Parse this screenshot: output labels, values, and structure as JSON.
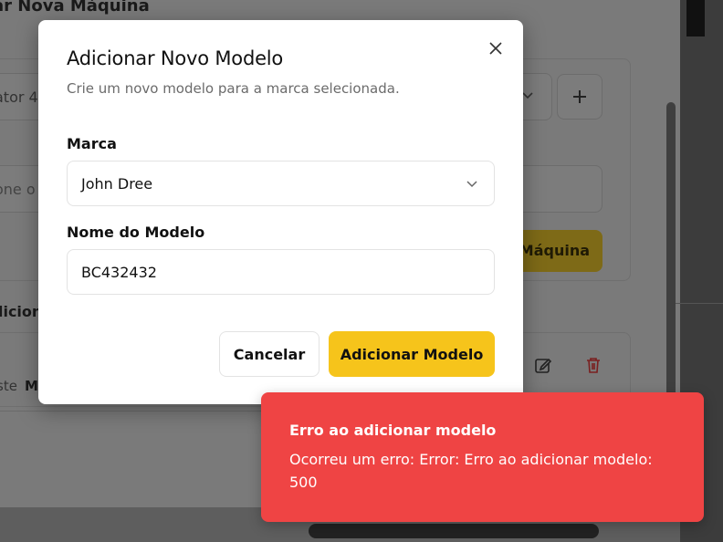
{
  "background": {
    "title": "ar Nova Máquina",
    "select_text": "ator 4x",
    "input_text": "one o",
    "button_label": "Máquina",
    "section_title": "dicion",
    "row_text": "ste",
    "row_bold": "M"
  },
  "dialog": {
    "title": "Adicionar Novo Modelo",
    "description": "Crie um novo modelo para a marca selecionada.",
    "brand_label": "Marca",
    "brand_value": "John Dree",
    "model_label": "Nome do Modelo",
    "model_value": "BC432432",
    "cancel_label": "Cancelar",
    "submit_label": "Adicionar Modelo"
  },
  "toast": {
    "title": "Erro ao adicionar modelo",
    "message": "Ocorreu um erro: Error: Erro ao adicionar modelo: 500"
  },
  "colors": {
    "accent": "#f6c41b",
    "error": "#ef4444"
  },
  "icons": {
    "close": "x-icon",
    "chevron": "chevron-down-icon",
    "plus": "plus-icon",
    "edit": "edit-icon",
    "trash": "trash-icon"
  }
}
